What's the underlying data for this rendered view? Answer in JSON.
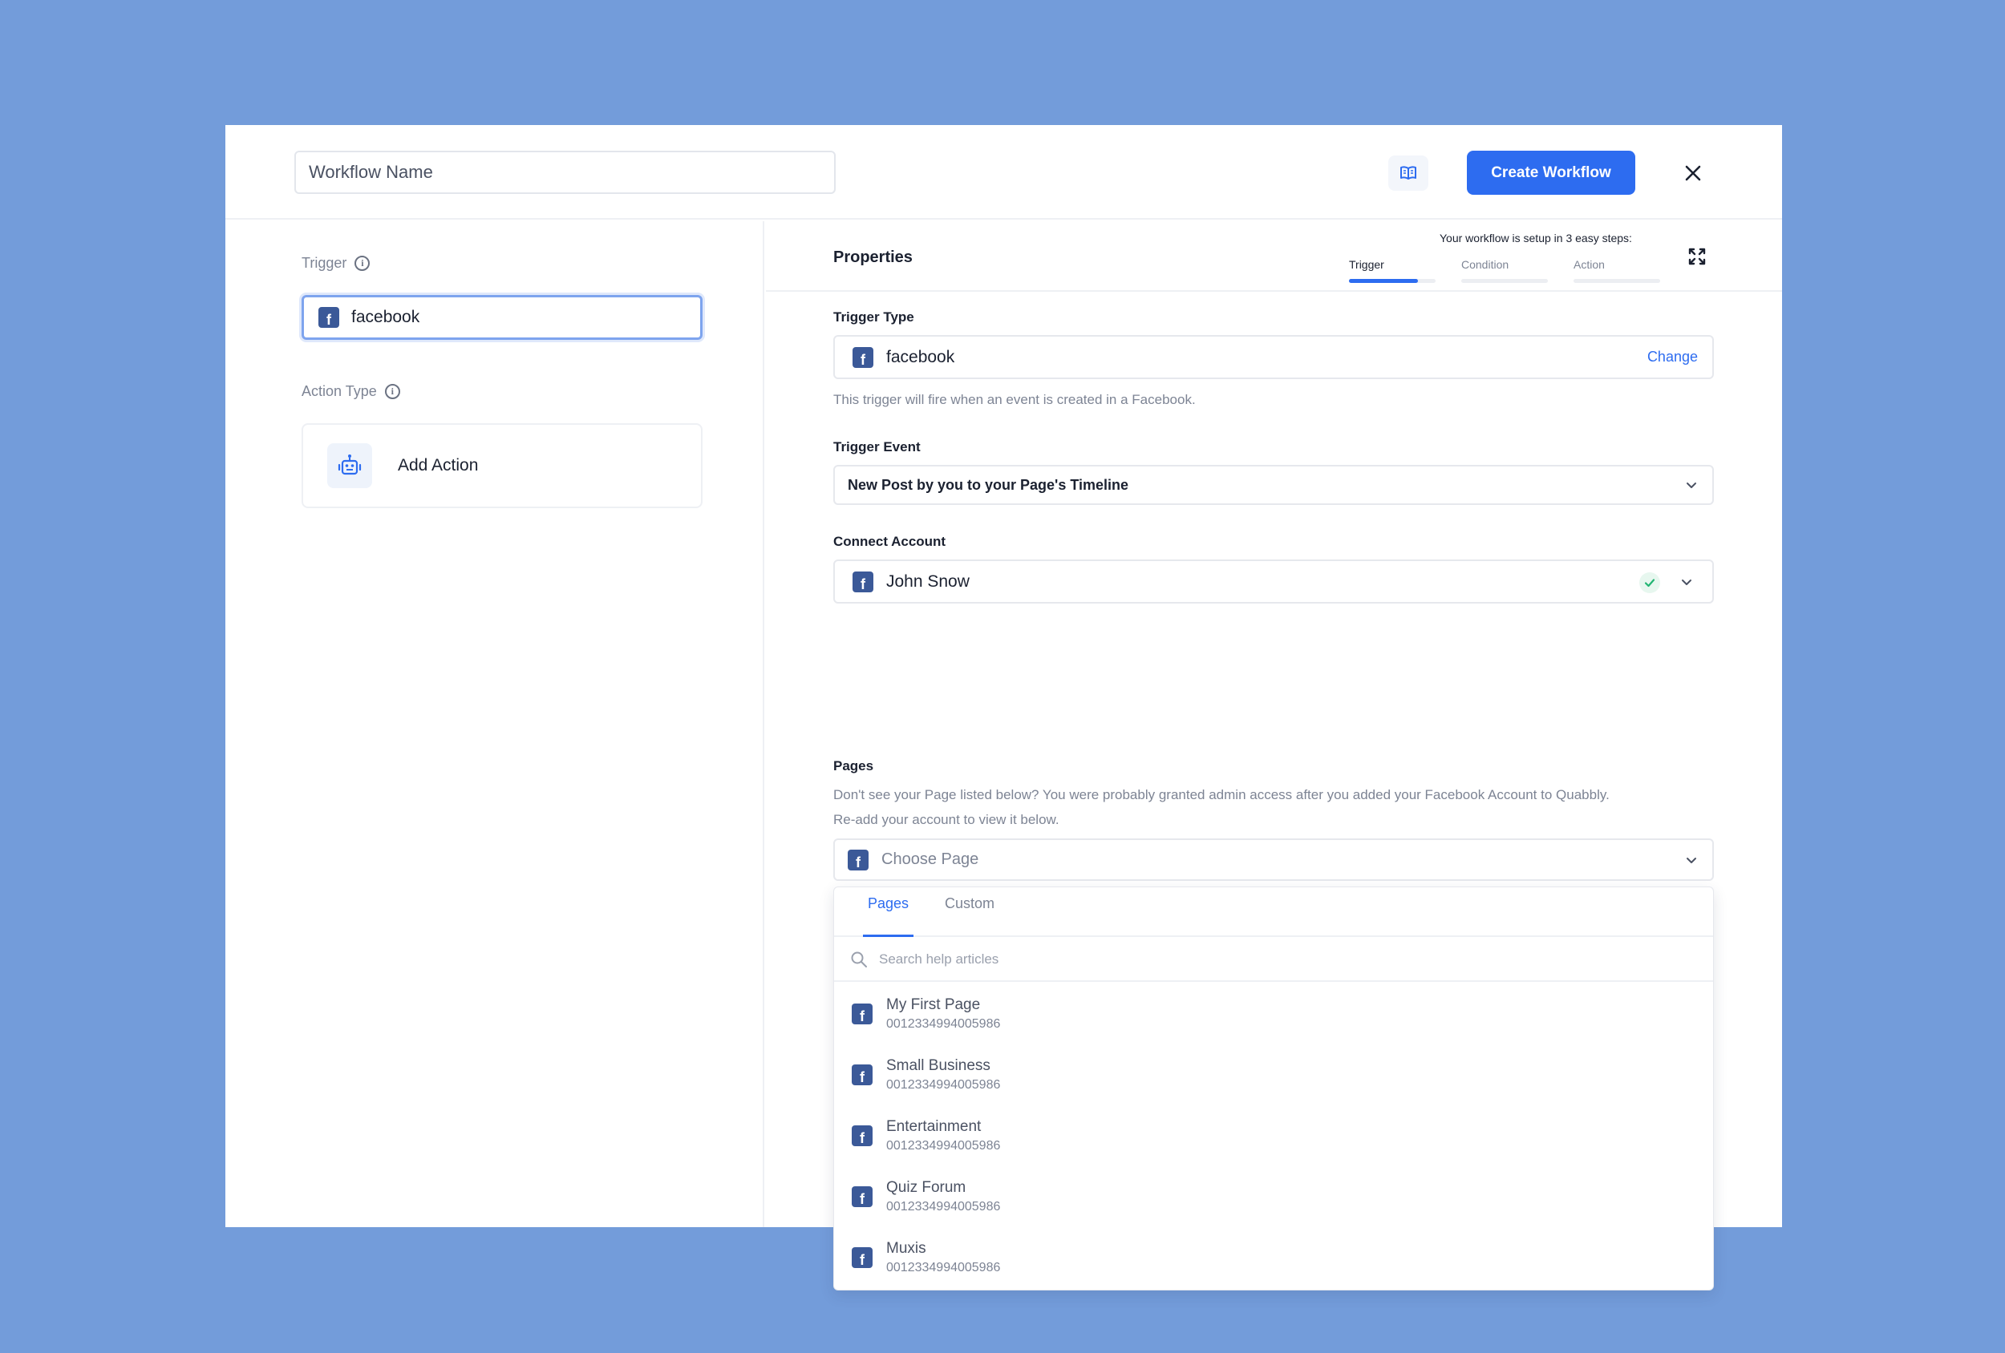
{
  "header": {
    "workflow_name_placeholder": "Workflow Name",
    "create_button": "Create Workflow",
    "book_icon": "book-icon",
    "close_icon": "close-icon"
  },
  "left_panel": {
    "trigger_label": "Trigger",
    "trigger_value": "facebook",
    "action_type_label": "Action Type",
    "add_action_label": "Add Action"
  },
  "properties": {
    "title": "Properties",
    "steps_caption": "Your workflow is setup in 3 easy steps:",
    "steps": [
      {
        "label": "Trigger",
        "progress": 0.8,
        "active": true
      },
      {
        "label": "Condition",
        "progress": 0,
        "active": false
      },
      {
        "label": "Action",
        "progress": 0,
        "active": false
      }
    ],
    "trigger_type_label": "Trigger Type",
    "trigger_type_value": "facebook",
    "change_link": "Change",
    "trigger_type_hint": "This trigger will fire when an event is created in a Facebook.",
    "trigger_event_label": "Trigger Event",
    "trigger_event_value": "New Post by you to your Page's Timeline",
    "connect_account_label": "Connect Account",
    "connect_account_value": "John Snow",
    "pages_label": "Pages",
    "pages_hint_line1": "Don't see your Page listed below? You were probably granted admin access after you added your Facebook Account to Quabbly.",
    "pages_hint_line2": "Re-add your account to view it below.",
    "choose_page_placeholder": "Choose Page"
  },
  "dropdown": {
    "tabs": [
      "Pages",
      "Custom"
    ],
    "active_tab": "Pages",
    "search_placeholder": "Search help articles",
    "items": [
      {
        "name": "My First Page",
        "id": "0012334994005986"
      },
      {
        "name": "Small Business",
        "id": "0012334994005986"
      },
      {
        "name": "Entertainment",
        "id": "0012334994005986"
      },
      {
        "name": "Quiz Forum",
        "id": "0012334994005986"
      },
      {
        "name": "Muxis",
        "id": "0012334994005986"
      }
    ]
  },
  "colors": {
    "background": "#739cda",
    "accent": "#2d6cf0",
    "facebook": "#3b5998",
    "success": "#22b573"
  }
}
